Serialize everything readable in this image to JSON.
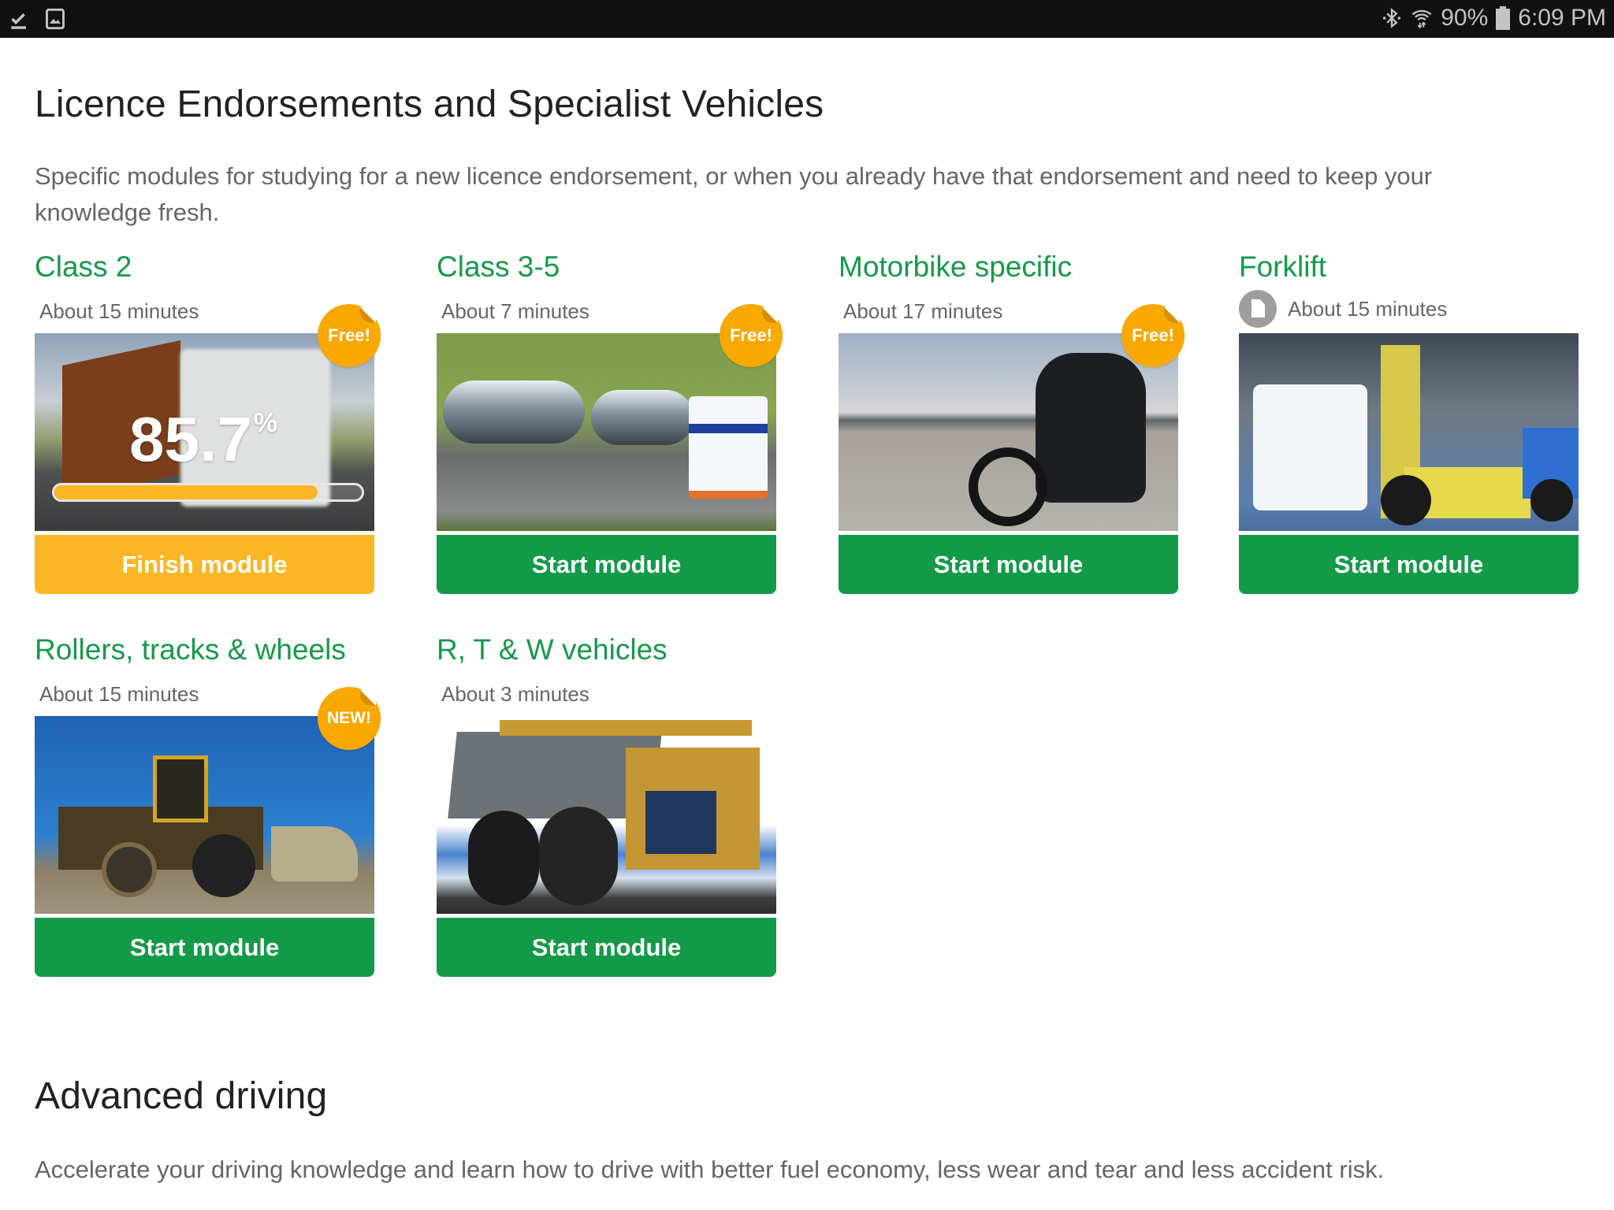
{
  "status_bar": {
    "left_icons": [
      "task-done-icon",
      "image-icon"
    ],
    "right_icons": [
      "bluetooth-icon",
      "wifi-icon",
      "battery-icon"
    ],
    "battery": "90%",
    "time": "6:09 PM"
  },
  "sections": [
    {
      "title": "Licence Endorsements and Specialist Vehicles",
      "description": "Specific modules for studying for a new licence endorsement, or when you already have that endorsement and need to keep your knowledge fresh."
    },
    {
      "title": "Advanced driving",
      "description": "Accelerate your driving knowledge and learn how to drive with better fuel economy, less wear and tear and less accident risk."
    }
  ],
  "modules": [
    {
      "title": "Class 2",
      "duration": "About 15 minutes",
      "badge": "Free!",
      "image": "curtainsider-truck",
      "progress": {
        "value": "85.7",
        "unit": "%",
        "percent": 85.7
      },
      "button": "Finish module",
      "button_color": "#fbb626"
    },
    {
      "title": "Class 3-5",
      "duration": "About 7 minutes",
      "badge": "Free!",
      "image": "tanker-truck-and-trailer",
      "button": "Start module",
      "button_color": "#139a49"
    },
    {
      "title": "Motorbike specific",
      "duration": "About 17 minutes",
      "badge": "Free!",
      "image": "motorcycle-rider",
      "button": "Start module",
      "button_color": "#139a49"
    },
    {
      "title": "Forklift",
      "duration": "About 15 minutes",
      "duration_icon": "document-icon",
      "image": "forklift-with-bags",
      "button": "Start module",
      "button_color": "#139a49"
    },
    {
      "title": "Rollers, tracks & wheels",
      "duration": "About 15 minutes",
      "badge": "NEW!",
      "image": "wheel-loader",
      "button": "Start module",
      "button_color": "#139a49"
    },
    {
      "title": "R, T & W vehicles",
      "duration": "About 3 minutes",
      "image": "mining-dump-truck",
      "button": "Start module",
      "button_color": "#139a49"
    }
  ],
  "colors": {
    "accent_green": "#16994a",
    "button_green": "#139a49",
    "button_amber": "#fbb626",
    "badge_orange": "#f9a800"
  }
}
